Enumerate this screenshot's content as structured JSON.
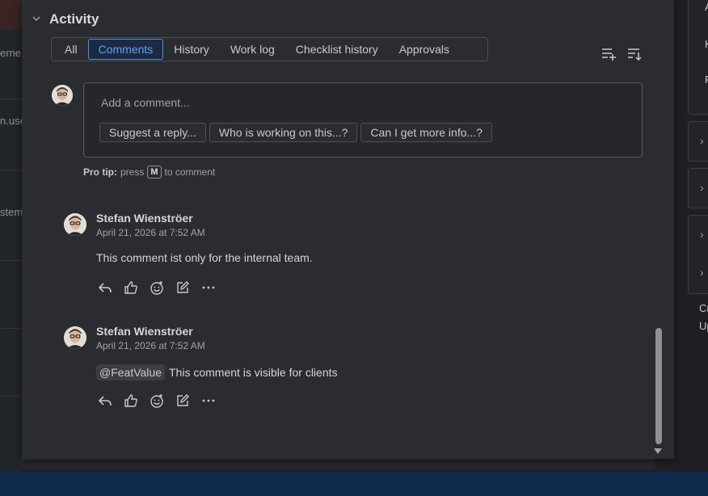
{
  "activity": {
    "title": "Activity",
    "tabs": [
      {
        "label": "All",
        "active": false
      },
      {
        "label": "Comments",
        "active": true
      },
      {
        "label": "History",
        "active": false
      },
      {
        "label": "Work log",
        "active": false
      },
      {
        "label": "Checklist history",
        "active": false
      },
      {
        "label": "Approvals",
        "active": false
      }
    ]
  },
  "composer": {
    "placeholder": "Add a comment...",
    "suggestions": [
      "Suggest a reply...",
      "Who is working on this...?",
      "Can I get more info...?"
    ]
  },
  "tip": {
    "label": "Pro tip:",
    "text_before": "press",
    "key": "M",
    "text_after": "to comment"
  },
  "comments": [
    {
      "author": "Stefan Wienströer",
      "time": "April 21, 2026 at 7:52 AM",
      "mention": "",
      "text": "This comment ist only for the internal team."
    },
    {
      "author": "Stefan Wienströer",
      "time": "April 21, 2026 at 7:52 AM",
      "mention": "@FeatValue",
      "text": "This comment is visible for clients"
    }
  ],
  "background": {
    "left_fragments": [
      "erne",
      "n.use",
      "stem"
    ],
    "right_fragments": [
      "A",
      "K",
      "F",
      "Cr",
      "Up"
    ]
  },
  "colors": {
    "panel": "#2b2c2f",
    "accent": "#5ea0ff",
    "text": "#c7c9ce"
  }
}
